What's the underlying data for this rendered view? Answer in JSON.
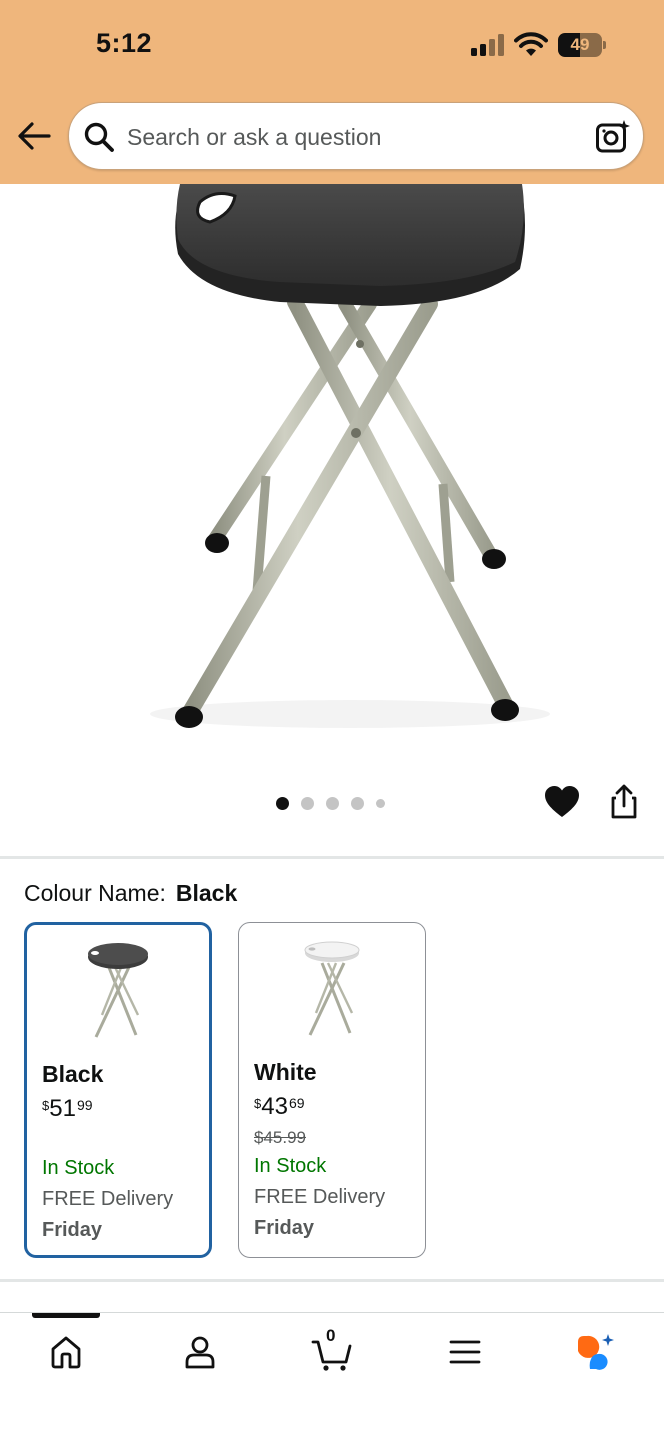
{
  "status_bar": {
    "time": "5:12",
    "battery": "49",
    "battery_level": 0.49
  },
  "search": {
    "placeholder": "Search or ask a question"
  },
  "icons": {
    "back": "back-arrow-icon",
    "search": "search-icon",
    "camera": "camera-lens-icon",
    "wishlist": "heart-icon",
    "share": "share-icon",
    "home": "home-icon",
    "account": "person-icon",
    "cart": "cart-icon",
    "menu": "menu-icon",
    "rufus": "rufus-assistant-icon"
  },
  "gallery": {
    "image_count": 5,
    "active_index": 0
  },
  "variation": {
    "label": "Colour Name:",
    "selected": "Black",
    "options": [
      {
        "name": "Black",
        "price_symbol": "$",
        "price_whole": "51",
        "price_fraction": "99",
        "was_price": "",
        "availability": "In Stock",
        "delivery": "FREE Delivery",
        "delivery_day": "Friday",
        "selected": true
      },
      {
        "name": "White",
        "price_symbol": "$",
        "price_whole": "43",
        "price_fraction": "69",
        "was_price": "$45.99",
        "availability": "In Stock",
        "delivery": "FREE Delivery",
        "delivery_day": "Friday",
        "selected": false
      }
    ]
  },
  "tabbar": {
    "cart_count": "0",
    "active_tab": "home"
  },
  "colors": {
    "header_bg": "#efb67c",
    "selected_border": "#2162a1",
    "in_stock": "#007600",
    "rufus_orange": "#ff6a13",
    "rufus_blue": "#1a8cff"
  }
}
